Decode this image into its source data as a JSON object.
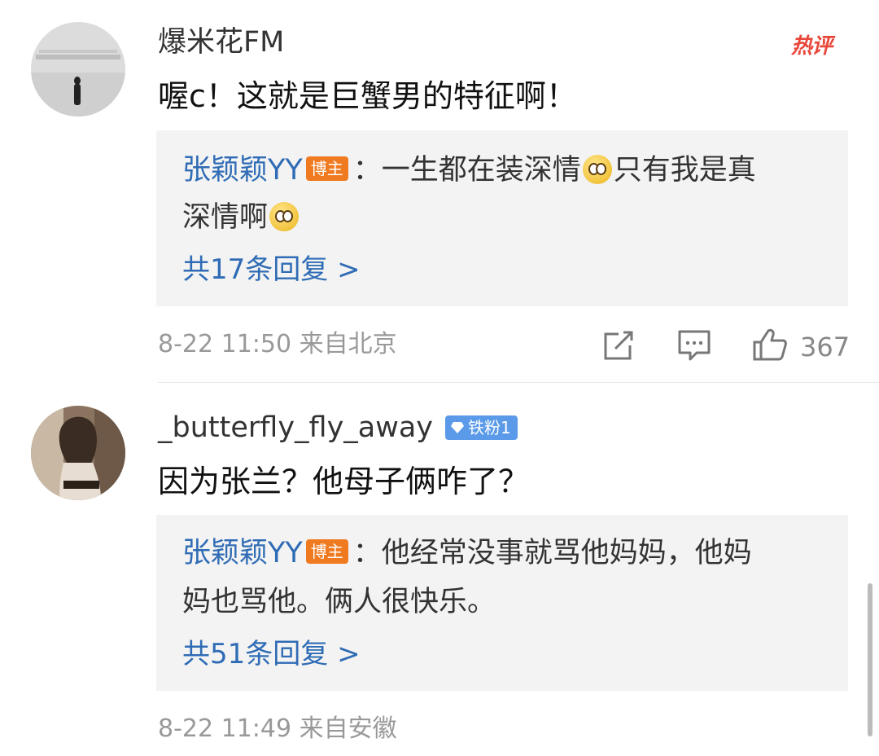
{
  "comments": [
    {
      "username": "爆米花FM",
      "hot_label": "热评",
      "text": "喔c！这就是巨蟹男的特征啊！",
      "reply": {
        "author": "张颖颖YY",
        "badge": "博主",
        "line1": "：一生都在装深情",
        "line1b": "只有我是真",
        "line2": "深情啊",
        "count_label": "共17条回复 >"
      },
      "timestamp": "8-22 11:50  来自北京",
      "likes": "367"
    },
    {
      "username": "_butterfly_fly_away",
      "fan_badge": "铁粉1",
      "text": "因为张兰？他母子俩咋了？",
      "reply": {
        "author": "张颖颖YY",
        "badge": "博主",
        "line1": "：他经常没事就骂他妈妈，他妈",
        "line2": "妈也骂他。俩人很快乐。",
        "count_label": "共51条回复 >"
      },
      "timestamp": "8-22 11:49  来自安徽"
    }
  ],
  "icons": [
    "share-icon",
    "comment-icon",
    "like-icon",
    "diamond-icon",
    "crying-emoji-icon"
  ],
  "colors": {
    "link_blue": "#2f6cb5",
    "hot_red": "#e8473a",
    "blogger_orange": "#f07a1f",
    "fan_blue": "#5a9ae8"
  }
}
